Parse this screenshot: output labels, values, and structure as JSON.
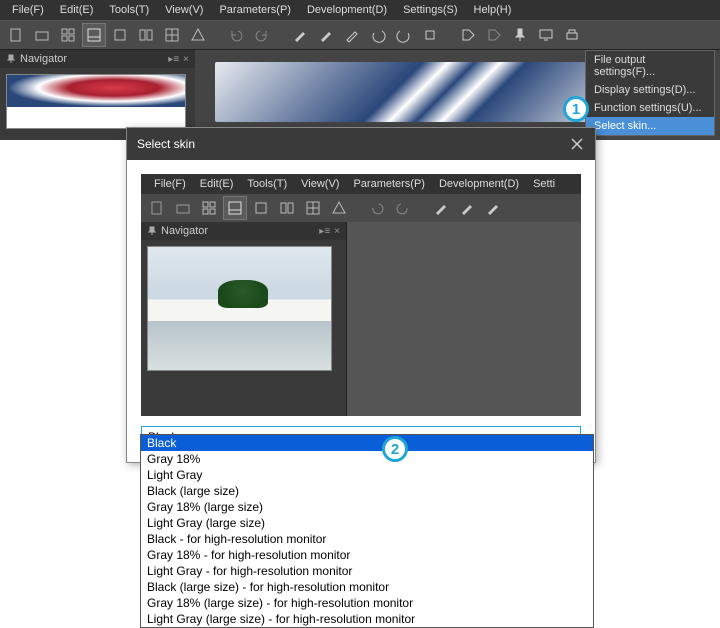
{
  "main_menu": {
    "file": "File(F)",
    "edit": "Edit(E)",
    "tools": "Tools(T)",
    "view": "View(V)",
    "parameters": "Parameters(P)",
    "development": "Development(D)",
    "settings": "Settings(S)",
    "help": "Help(H)"
  },
  "navigator_title": "Navigator",
  "settings_menu": {
    "file_output": "File output settings(F)...",
    "display": "Display settings(D)...",
    "function": "Function settings(U)...",
    "select_skin": "Select skin..."
  },
  "dialog": {
    "title": "Select skin",
    "preview_menu": {
      "file": "File(F)",
      "edit": "Edit(E)",
      "tools": "Tools(T)",
      "view": "View(V)",
      "parameters": "Parameters(P)",
      "development": "Development(D)",
      "settings": "Setti"
    },
    "preview_nav_title": "Navigator"
  },
  "combo_selected": "Black",
  "skin_options": [
    "Black",
    "Gray 18%",
    "Light Gray",
    "Black (large size)",
    "Gray 18% (large size)",
    "Light Gray (large size)",
    "Black - for high-resolution monitor",
    "Gray 18% - for high-resolution monitor",
    "Light Gray - for high-resolution monitor",
    "Black (large size) - for high-resolution monitor",
    "Gray 18% (large size) - for high-resolution monitor",
    "Light Gray (large size) - for high-resolution monitor"
  ],
  "callouts": {
    "one": "1",
    "two": "2"
  }
}
